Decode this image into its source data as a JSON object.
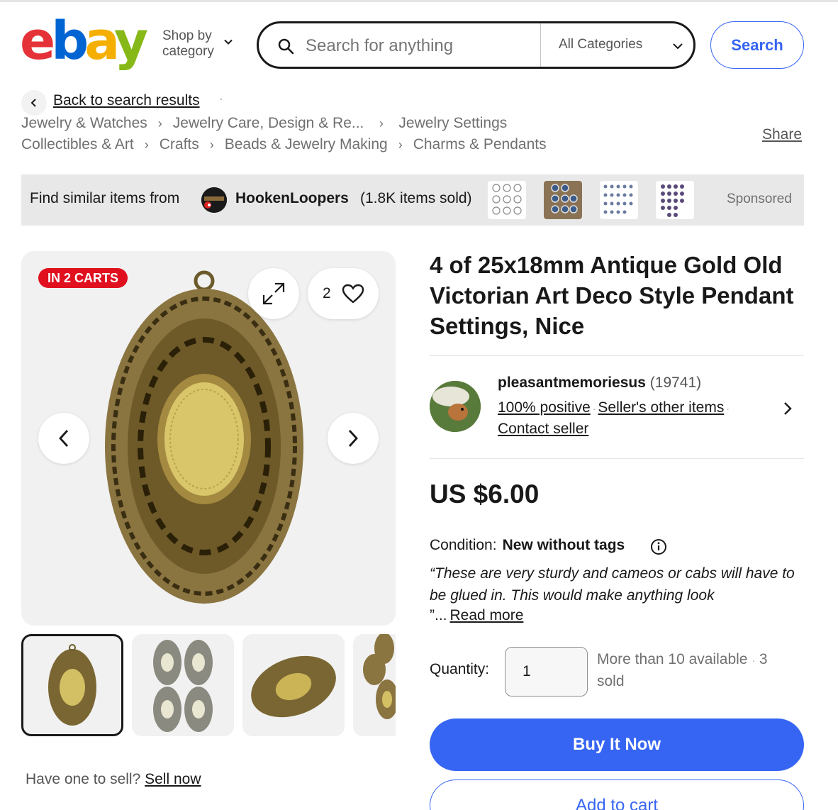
{
  "brand": {
    "logo_letters": [
      "e",
      "b",
      "a",
      "y"
    ],
    "colors": {
      "e": "#e53238",
      "b": "#0064d2",
      "a": "#f5af02",
      "y": "#86b817"
    }
  },
  "header": {
    "shop_by_line1": "Shop by",
    "shop_by_line2": "category",
    "search_placeholder": "Search for anything",
    "category_select": "All Categories",
    "search_button": "Search",
    "accent_color": "#3665f3"
  },
  "breadcrumbs": {
    "back_label": "Back to search results",
    "row1": [
      "Jewelry & Watches",
      "Jewelry Care, Design & Re...",
      "Jewelry Settings"
    ],
    "row2": [
      "Collectibles & Art",
      "Crafts",
      "Beads & Jewelry Making",
      "Charms & Pendants"
    ],
    "share": "Share"
  },
  "banner": {
    "prefix": "Find similar items from",
    "seller": "HookenLoopers",
    "sold": "(1.8K items sold)",
    "sponsored": "Sponsored"
  },
  "gallery": {
    "badge": "IN 2 CARTS",
    "watch_count": "2",
    "icons": [
      "expand-icon",
      "heart-icon",
      "chevron-left-icon",
      "chevron-right-icon"
    ]
  },
  "item": {
    "title": "4 of 25x18mm Antique Gold Old Victorian Art Deco Style Pendant Settings, Nice",
    "seller_name": "pleasantmemoriesus",
    "seller_feedback": "(19741)",
    "positive": "100% positive",
    "other_items": "Seller's other items",
    "contact": "Contact seller",
    "price": "US $6.00",
    "condition_label": "Condition:",
    "condition_value": "New without tags",
    "quote": "“These are very sturdy and cameos or cabs will have to be glued in. This would make anything look",
    "quote_end": "”...",
    "read_more": "Read more",
    "quantity_label": "Quantity:",
    "quantity_value": "1",
    "availability": "More than 10 available",
    "sold": "3 sold",
    "buy_now": "Buy It Now",
    "add_to_cart": "Add to cart"
  },
  "footer": {
    "have_one": "Have one to sell?",
    "sell_now": "Sell now"
  }
}
